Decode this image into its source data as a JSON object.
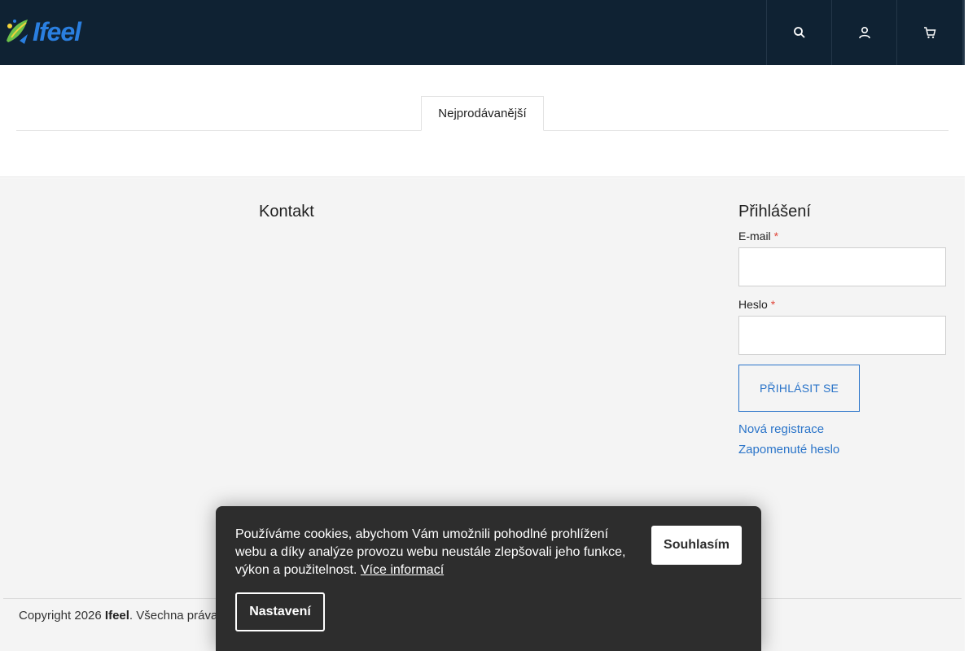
{
  "header": {
    "logo_text": "Ifeel",
    "icons": [
      "search-icon",
      "user-icon",
      "cart-icon"
    ],
    "colors": {
      "background": "#0f2233",
      "logo": "#2a7fe0"
    }
  },
  "tabs": [
    {
      "label": "Nejprodávanější",
      "active": true
    }
  ],
  "footer": {
    "kontakt_title": "Kontakt",
    "login": {
      "title": "Přihlášení",
      "email_label": "E-mail",
      "password_label": "Heslo",
      "required_marker": "*",
      "email_value": "",
      "password_value": "",
      "submit_label": "PŘIHLÁSIT SE",
      "register_link": "Nová registrace",
      "forgot_link": "Zapomenuté heslo"
    },
    "copyright": {
      "prefix": "Copyright 2026 ",
      "brand": "Ifeel",
      "suffix": ". Všechna práva"
    }
  },
  "cookie_banner": {
    "text": "Používáme cookies, abychom Vám umožnili pohodlné prohlížení webu a díky analýze provozu webu neustále zlepšovali jeho funkce, výkon a použitelnost.",
    "more_info_link": "Více informací",
    "agree_label": "Souhlasím",
    "settings_label": "Nastavení"
  },
  "colors": {
    "accent": "#2a74c9",
    "required": "#e0463a",
    "footer_bg": "#f4f4f4",
    "cookie_bg": "#2d2d2d"
  }
}
